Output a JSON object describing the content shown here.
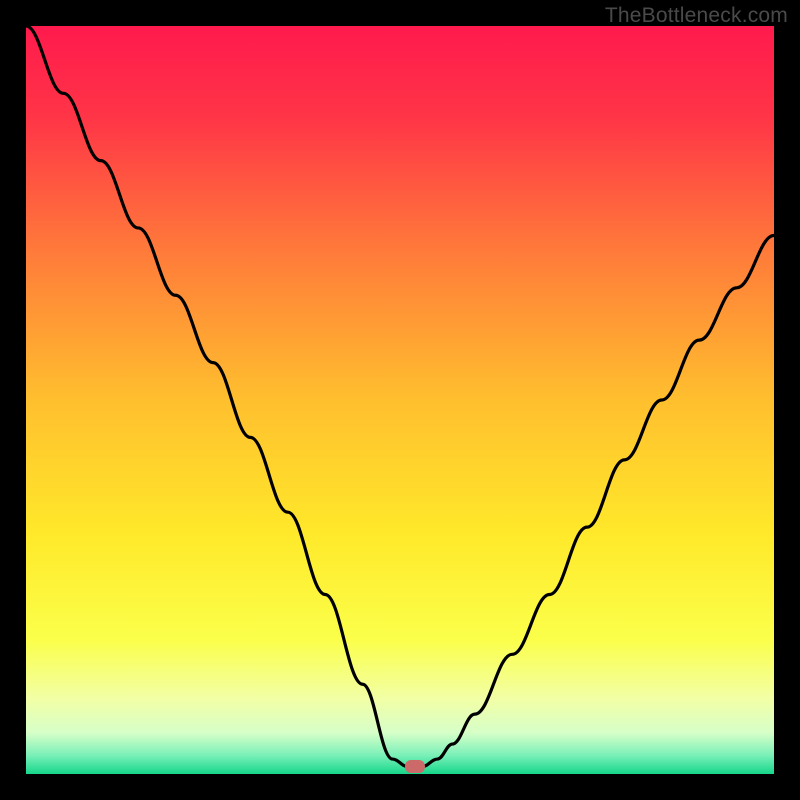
{
  "watermark": "TheBottleneck.com",
  "chart_data": {
    "type": "line",
    "title": "",
    "xlabel": "",
    "ylabel": "",
    "xlim": [
      0,
      100
    ],
    "ylim": [
      0,
      100
    ],
    "grid": false,
    "series": [
      {
        "name": "bottleneck-curve",
        "x": [
          0,
          5,
          10,
          15,
          20,
          25,
          30,
          35,
          40,
          45,
          49,
          51,
          53,
          55,
          57,
          60,
          65,
          70,
          75,
          80,
          85,
          90,
          95,
          100
        ],
        "y": [
          100,
          91,
          82,
          73,
          64,
          55,
          45,
          35,
          24,
          12,
          2,
          1,
          1,
          2,
          4,
          8,
          16,
          24,
          33,
          42,
          50,
          58,
          65,
          72
        ]
      }
    ],
    "marker_point": {
      "x": 52,
      "y": 1
    },
    "gradient_stops": [
      {
        "offset": 0.0,
        "color": "#ff1a4d"
      },
      {
        "offset": 0.12,
        "color": "#ff3447"
      },
      {
        "offset": 0.3,
        "color": "#ff7a3a"
      },
      {
        "offset": 0.5,
        "color": "#ffbf2e"
      },
      {
        "offset": 0.68,
        "color": "#ffe92a"
      },
      {
        "offset": 0.82,
        "color": "#fbff4a"
      },
      {
        "offset": 0.9,
        "color": "#f2ffa6"
      },
      {
        "offset": 0.945,
        "color": "#d6ffc8"
      },
      {
        "offset": 0.975,
        "color": "#7af0b8"
      },
      {
        "offset": 1.0,
        "color": "#16d68a"
      }
    ]
  }
}
